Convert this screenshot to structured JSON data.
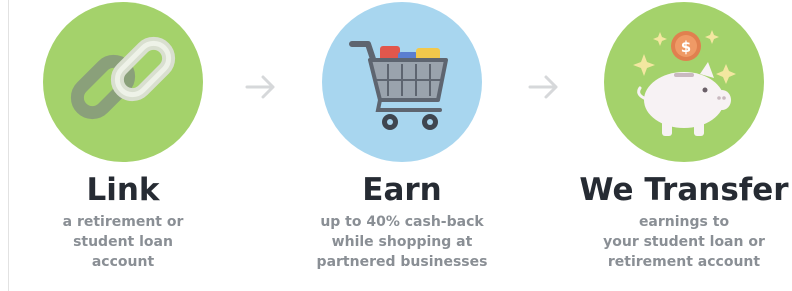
{
  "steps": [
    {
      "title": "Link",
      "description": [
        "a retirement or",
        "student loan",
        "account"
      ],
      "icon": "chain-link-icon",
      "circle_color": "#a4d26b"
    },
    {
      "title": "Earn",
      "description": [
        "up to 40% cash-back",
        "while shopping at",
        "partnered businesses"
      ],
      "icon": "shopping-cart-icon",
      "circle_color": "#a8d6ef"
    },
    {
      "title": "We Transfer",
      "description": [
        "earnings to",
        "your student loan or",
        "retirement account"
      ],
      "icon": "piggy-bank-icon",
      "circle_color": "#a4d26b"
    }
  ],
  "arrows": [
    "arrow-right-icon",
    "arrow-right-icon"
  ],
  "coin_symbol": "$"
}
